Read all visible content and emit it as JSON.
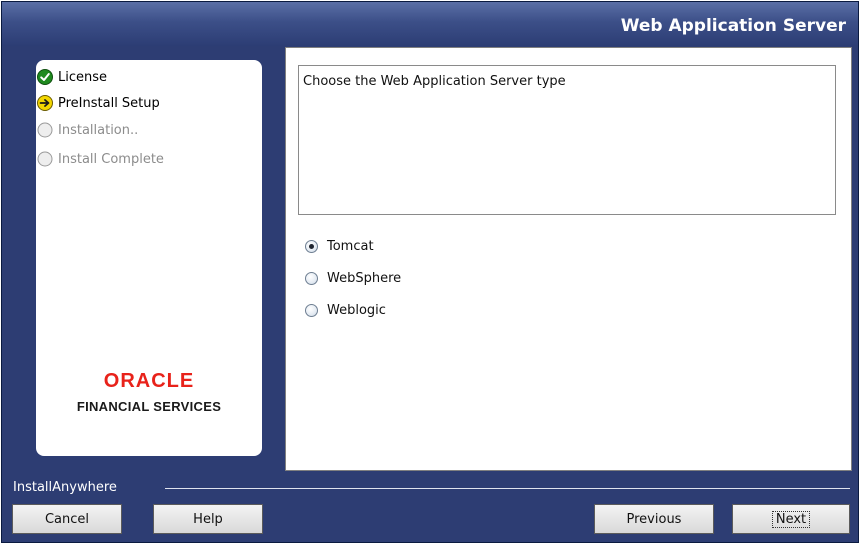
{
  "header": {
    "title": "Web Application Server"
  },
  "steps": [
    {
      "label": "License",
      "state": "done"
    },
    {
      "label": "PreInstall Setup",
      "state": "current"
    },
    {
      "label": "Installation..",
      "state": "pending"
    },
    {
      "label": "Install Complete",
      "state": "pending"
    }
  ],
  "logo": {
    "brand": "ORACLE",
    "subtitle": "FINANCIAL SERVICES"
  },
  "main": {
    "description": "Choose the Web Application Server type",
    "options": [
      {
        "label": "Tomcat",
        "selected": true
      },
      {
        "label": "WebSphere",
        "selected": false
      },
      {
        "label": "Weblogic",
        "selected": false
      }
    ]
  },
  "footer": {
    "vendor": "InstallAnywhere",
    "cancel_label": "Cancel",
    "help_label": "Help",
    "previous_label": "Previous",
    "next_label": "Next"
  },
  "colors": {
    "window_bg": "#2d3d73",
    "header_bg": "#3c4f88",
    "done_icon": "#1f8a1f",
    "current_icon": "#f2d600",
    "oracle_red": "#e8221a"
  },
  "icons": {
    "done": "check-circle-icon",
    "current": "arrow-right-circle-icon",
    "pending": "empty-circle-icon"
  }
}
